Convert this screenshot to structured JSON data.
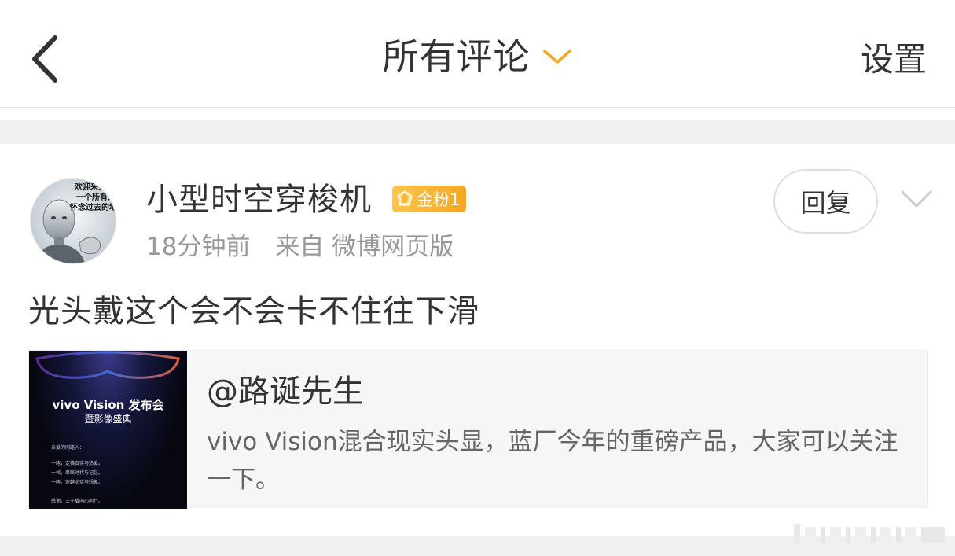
{
  "header": {
    "back_icon": "chevron-left-icon",
    "title": "所有评论",
    "title_icon": "chevron-down-icon",
    "settings_label": "设置"
  },
  "comment": {
    "avatar_lines": [
      "欢迎来到",
      "一个所有人",
      "怀念过去的地"
    ],
    "username": "小型时空穿梭机",
    "badge": {
      "label": "金粉1",
      "icon": "diamond-icon"
    },
    "time": "18分钟前",
    "source": "来自 微博网页版",
    "reply_label": "回复",
    "more_icon": "chevron-down-icon",
    "text": "光头戴这个会不会卡不住往下滑"
  },
  "repost": {
    "thumbnail": {
      "title": "vivo Vision 发布会",
      "subtitle": "暨影像盛典",
      "lines": [
        "亲爱的同路人：",
        "一睹，定格真实与热爱。",
        "一帧，串联时代与记忆。",
        "一眸，穿越虚实与想象。",
        "感谢，三十载同心同行。"
      ]
    },
    "author": "@路诞先生",
    "text": "vivo Vision混合现实头显，蓝厂今年的重磅产品，大家可以关注一下。"
  },
  "colors": {
    "accent_orange": "#f5a623",
    "text_primary": "#333333",
    "text_secondary": "#999999",
    "separator": "#f0f0f0",
    "card_bg": "#f6f6f6"
  }
}
